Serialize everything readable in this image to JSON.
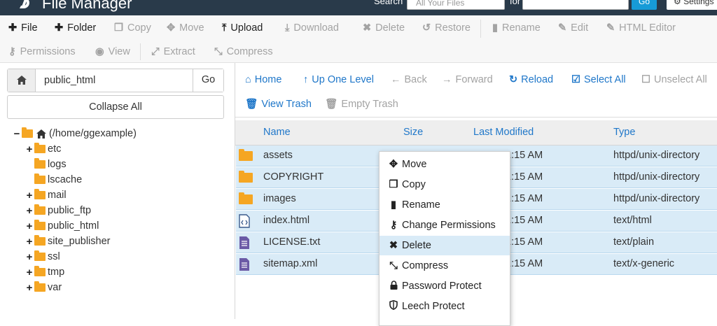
{
  "header": {
    "title": "File Manager",
    "search_label": "Search",
    "search_scope": "All Your Files",
    "for_label": "for",
    "go_label": "Go",
    "settings_label": "Settings"
  },
  "toolbar": {
    "row1": [
      {
        "label": "File",
        "icon": "plus-icon",
        "enabled": true
      },
      {
        "label": "Folder",
        "icon": "plus-icon",
        "enabled": true
      },
      {
        "label": "Copy",
        "icon": "copy-icon",
        "enabled": false
      },
      {
        "label": "Move",
        "icon": "move-icon",
        "enabled": false
      },
      {
        "label": "Upload",
        "icon": "upload-icon",
        "enabled": true
      },
      {
        "label": "Download",
        "icon": "download-icon",
        "enabled": false
      },
      {
        "label": "Delete",
        "icon": "delete-icon",
        "enabled": false
      },
      {
        "label": "Restore",
        "icon": "restore-icon",
        "enabled": false
      },
      {
        "label": "Rename",
        "icon": "file-icon",
        "enabled": false
      },
      {
        "label": "Edit",
        "icon": "pencil-icon",
        "enabled": false
      },
      {
        "label": "HTML Editor",
        "icon": "edit-square-icon",
        "enabled": false
      }
    ],
    "row2": [
      {
        "label": "Permissions",
        "icon": "key-icon",
        "enabled": false
      },
      {
        "label": "View",
        "icon": "eye-icon",
        "enabled": false
      },
      {
        "label": "Extract",
        "icon": "expand-icon",
        "enabled": false
      },
      {
        "label": "Compress",
        "icon": "compress-icon",
        "enabled": false
      }
    ]
  },
  "sidebar": {
    "path_value": "public_html",
    "go_label": "Go",
    "collapse_label": "Collapse All",
    "root_label": "(/home/ggexample)",
    "tree": [
      {
        "label": "etc",
        "expandable": true
      },
      {
        "label": "logs",
        "expandable": false
      },
      {
        "label": "lscache",
        "expandable": false
      },
      {
        "label": "mail",
        "expandable": true
      },
      {
        "label": "public_ftp",
        "expandable": true
      },
      {
        "label": "public_html",
        "expandable": true
      },
      {
        "label": "site_publisher",
        "expandable": true
      },
      {
        "label": "ssl",
        "expandable": true
      },
      {
        "label": "tmp",
        "expandable": true
      },
      {
        "label": "var",
        "expandable": true
      }
    ]
  },
  "navbar": {
    "row1": [
      {
        "label": "Home",
        "icon": "home-icon",
        "enabled": true
      },
      {
        "label": "Up One Level",
        "icon": "up-arrow-icon",
        "enabled": true
      },
      {
        "label": "Back",
        "icon": "left-arrow-icon",
        "enabled": false
      },
      {
        "label": "Forward",
        "icon": "right-arrow-icon",
        "enabled": false
      },
      {
        "label": "Reload",
        "icon": "reload-icon",
        "enabled": true
      },
      {
        "label": "Select All",
        "icon": "checked-box-icon",
        "enabled": true
      },
      {
        "label": "Unselect All",
        "icon": "empty-box-icon",
        "enabled": false
      }
    ],
    "row2": [
      {
        "label": "View Trash",
        "icon": "trash-icon",
        "enabled": true
      },
      {
        "label": "Empty Trash",
        "icon": "trash-icon",
        "enabled": false
      }
    ]
  },
  "table": {
    "columns": [
      "Name",
      "Size",
      "Last Modified",
      "Type"
    ],
    "rows": [
      {
        "name": "assets",
        "kind": "folder",
        "modified": "1:15 AM",
        "type": "httpd/unix-directory"
      },
      {
        "name": "COPYRIGHT",
        "kind": "folder",
        "modified": "1:15 AM",
        "type": "httpd/unix-directory"
      },
      {
        "name": "images",
        "kind": "folder",
        "modified": "1:15 AM",
        "type": "httpd/unix-directory"
      },
      {
        "name": "index.html",
        "kind": "html",
        "modified": "1:15 AM",
        "type": "text/html"
      },
      {
        "name": "LICENSE.txt",
        "kind": "text",
        "modified": "1:15 AM",
        "type": "text/plain"
      },
      {
        "name": "sitemap.xml",
        "kind": "text",
        "modified": "1:15 AM",
        "type": "text/x-generic"
      }
    ]
  },
  "context_menu": {
    "items": [
      {
        "label": "Move",
        "icon": "move-icon",
        "highlighted": false
      },
      {
        "label": "Copy",
        "icon": "copy-icon",
        "highlighted": false
      },
      {
        "label": "Rename",
        "icon": "file-icon",
        "highlighted": false
      },
      {
        "label": "Change Permissions",
        "icon": "key-icon",
        "highlighted": false
      },
      {
        "label": "Delete",
        "icon": "delete-icon",
        "highlighted": true
      },
      {
        "label": "Compress",
        "icon": "compress-icon",
        "highlighted": false
      },
      {
        "label": "Password Protect",
        "icon": "lock-icon",
        "highlighted": false
      },
      {
        "label": "Leech Protect",
        "icon": "shield-icon",
        "highlighted": false
      }
    ]
  },
  "colors": {
    "header_bg": "#293a4a",
    "link_blue": "#1f77c9",
    "selection_blue": "#d9ebf7",
    "folder_orange": "#f5a623",
    "file_purple": "#6b5aa6"
  }
}
